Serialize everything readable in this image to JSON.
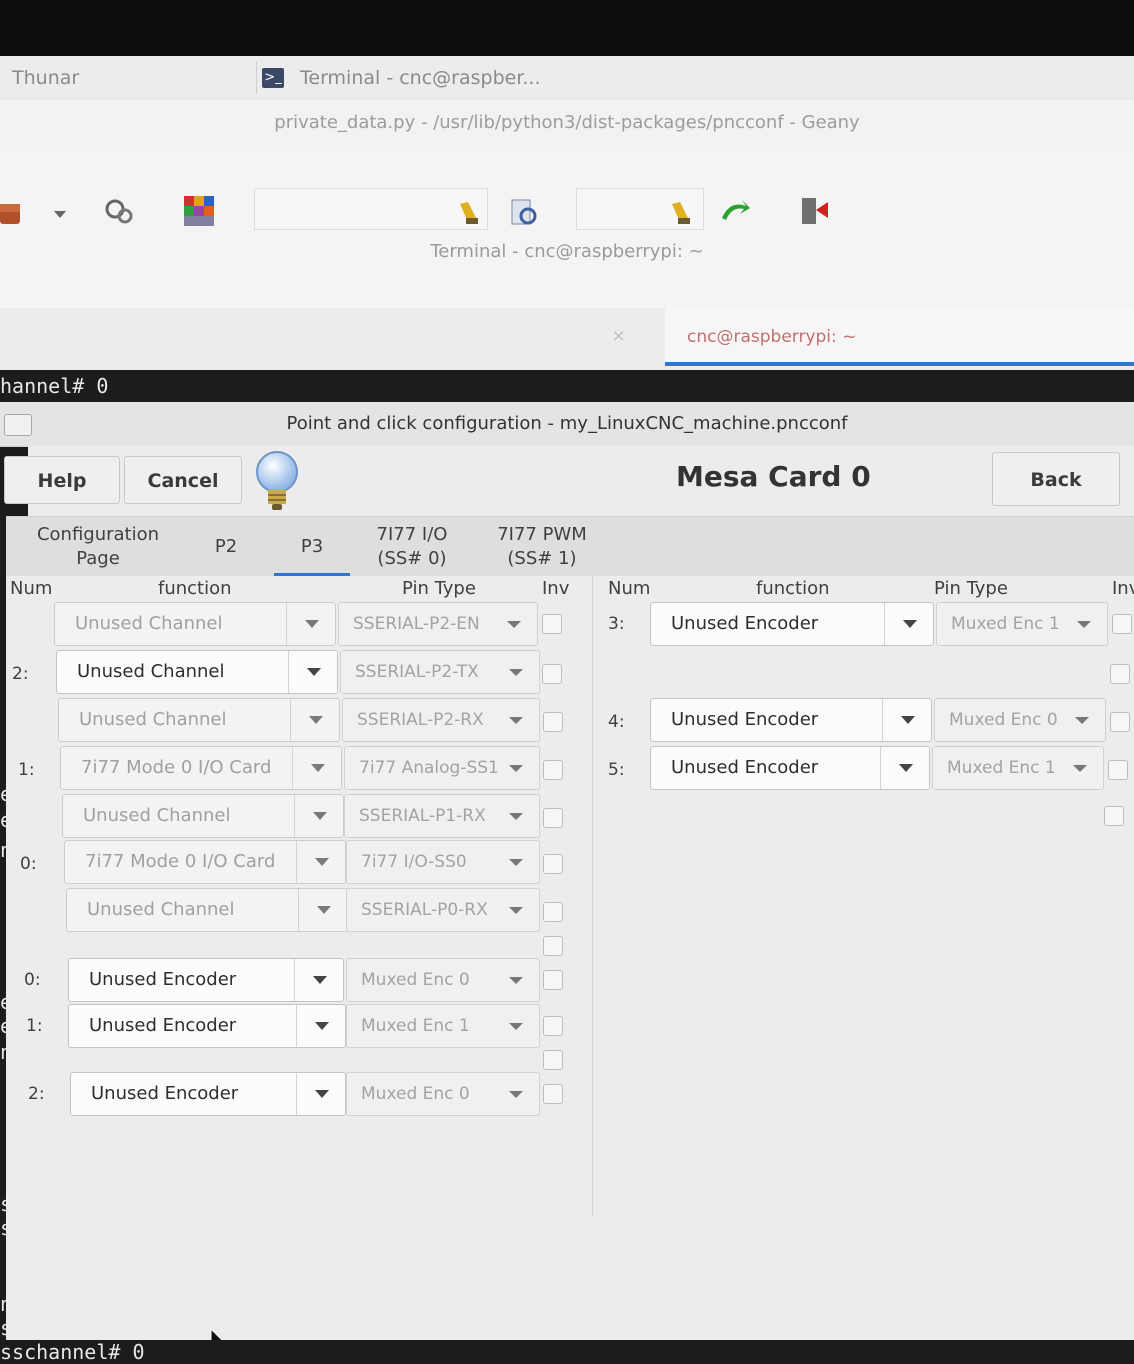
{
  "taskbar": {
    "thunar": "Thunar",
    "terminal": "Terminal - cnc@raspber..."
  },
  "geany": {
    "title": "private_data.py - /usr/lib/python3/dist-packages/pncconf - Geany"
  },
  "terminal": {
    "title": "Terminal - cnc@raspberrypi: ~",
    "tab_label": "cnc@raspberrypi: ~",
    "tab_close": "×",
    "line_top": "hannel# 0",
    "line_bottom": "sschannel# 0",
    "left_fragments": [
      "e",
      "e",
      "n",
      "e",
      "e",
      "n",
      "ss",
      "ss",
      "ne",
      "ss"
    ]
  },
  "pncconf": {
    "title": "Point and click configuration - my_LinuxCNC_machine.pncconf",
    "help": "Help",
    "cancel": "Cancel",
    "card_title": "Mesa Card 0",
    "back": "Back",
    "tabs": {
      "config": "Configuration\nPage",
      "p2": "P2",
      "p3": "P3",
      "io": "7I77 I/O\n(SS# 0)",
      "pwm": "7I77 PWM\n(SS# 1)"
    },
    "headers": {
      "num": "Num",
      "function": "function",
      "pin_type": "Pin Type",
      "inv": "Inv",
      "num2": "Num",
      "function2": "function",
      "pin_type2": "Pin Type",
      "inv2": "Inv"
    },
    "left_rows": [
      {
        "num": "",
        "function": "Unused Channel",
        "pin_type": "SSERIAL-P2-EN"
      },
      {
        "num": "2:",
        "function": "Unused Channel",
        "pin_type": "SSERIAL-P2-TX"
      },
      {
        "num": "",
        "function": "Unused Channel",
        "pin_type": "SSERIAL-P2-RX"
      },
      {
        "num": "1:",
        "function": "7i77 Mode 0 I/O Card",
        "pin_type": "7i77 Analog-SS1"
      },
      {
        "num": "",
        "function": "Unused Channel",
        "pin_type": "SSERIAL-P1-RX"
      },
      {
        "num": "0:",
        "function": "7i77 Mode 0 I/O Card",
        "pin_type": "7i77 I/O-SS0"
      },
      {
        "num": "",
        "function": "Unused Channel",
        "pin_type": "SSERIAL-P0-RX"
      },
      {
        "num": "0:",
        "function": "Unused Encoder",
        "pin_type": "Muxed Enc 0"
      },
      {
        "num": "1:",
        "function": "Unused Encoder",
        "pin_type": "Muxed Enc 1"
      },
      {
        "num": "2:",
        "function": "Unused Encoder",
        "pin_type": "Muxed Enc 0"
      }
    ],
    "right_rows": [
      {
        "num": "3:",
        "function": "Unused Encoder",
        "pin_type": "Muxed Enc 1"
      },
      {
        "num": "4:",
        "function": "Unused Encoder",
        "pin_type": "Muxed Enc 0"
      },
      {
        "num": "5:",
        "function": "Unused Encoder",
        "pin_type": "Muxed Enc 1"
      }
    ]
  }
}
